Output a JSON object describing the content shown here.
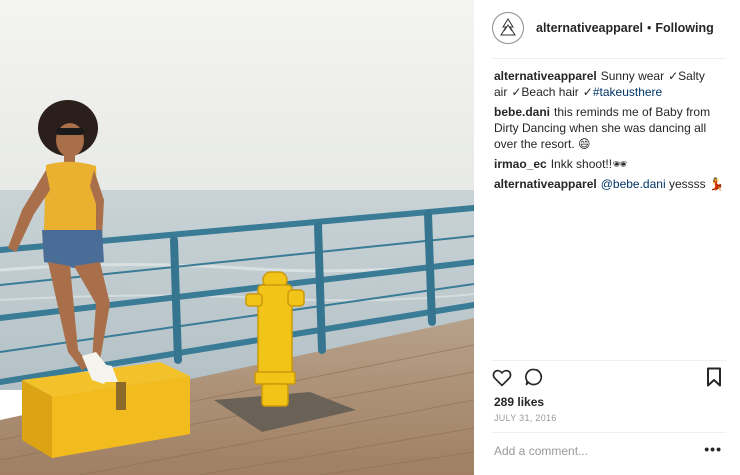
{
  "photo": {
    "alt_icon": "instagram-post-photo"
  },
  "header": {
    "username": "alternativeapparel",
    "separator": "•",
    "follow_state": "Following",
    "avatar_icon": "alternative-apparel-logo-icon"
  },
  "comments": [
    {
      "user": "alternativeapparel",
      "parts": [
        "Sunny wear",
        "✓",
        "Salty air",
        "✓",
        "Beach hair",
        "✓"
      ],
      "hashtag": "#takeusthere"
    },
    {
      "user": "bebe.dani",
      "text": "this reminds me of Baby from Dirty Dancing when she was dancing all over the resort.",
      "emoji": "😄"
    },
    {
      "user": "irmao_ec",
      "text": "Inkk shoot!!",
      "emoji": "🕶"
    },
    {
      "user": "alternativeapparel",
      "mention": "@bebe.dani",
      "text": "yessss",
      "emoji": "💃"
    }
  ],
  "actions": {
    "like_icon": "heart-icon",
    "comment_icon": "comment-bubble-icon",
    "save_icon": "bookmark-icon"
  },
  "likes": "289 likes",
  "date": "JULY 31, 2016",
  "add_comment": {
    "placeholder": "Add a comment...",
    "value": ""
  },
  "more_label": "•••",
  "colors": {
    "text": "#262626",
    "muted": "#999999",
    "link": "#003569",
    "divider": "#efefef",
    "railing": "#3a7b96",
    "hydrant": "#f2c417"
  }
}
